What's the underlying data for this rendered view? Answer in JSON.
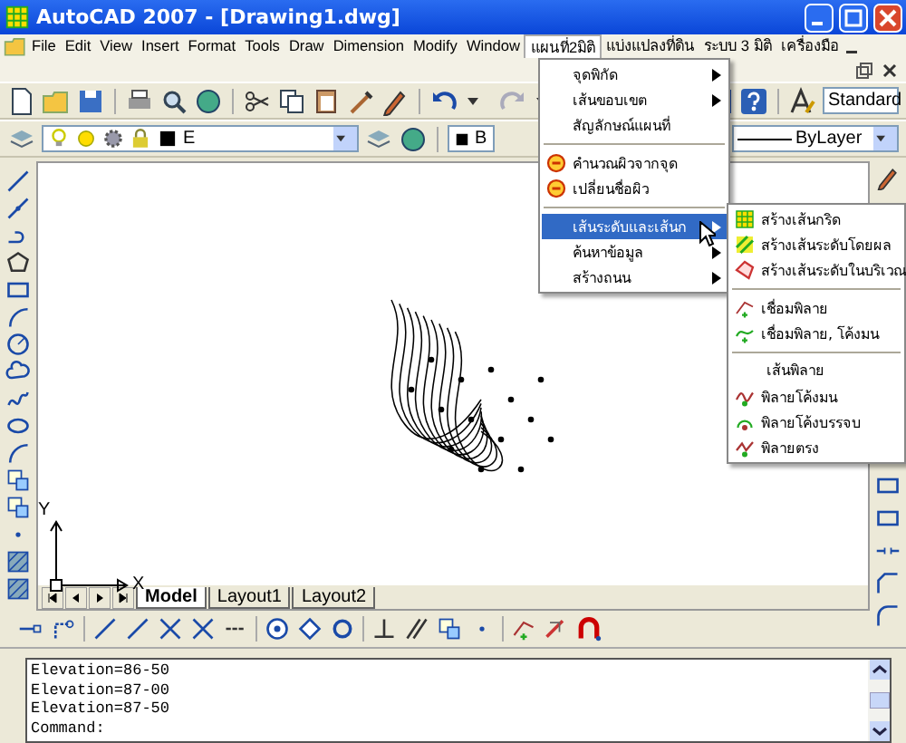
{
  "window": {
    "title": "AutoCAD 2007 - [Drawing1.dwg]"
  },
  "menu_bar": [
    {
      "label": "File",
      "selected": false
    },
    {
      "label": "Edit",
      "selected": false
    },
    {
      "label": "View",
      "selected": false
    },
    {
      "label": "Insert",
      "selected": false
    },
    {
      "label": "Format",
      "selected": false
    },
    {
      "label": "Tools",
      "selected": false
    },
    {
      "label": "Draw",
      "selected": false
    },
    {
      "label": "Dimension",
      "selected": false
    },
    {
      "label": "Modify",
      "selected": false
    },
    {
      "label": "Window",
      "selected": false
    },
    {
      "label": "แผนที่2มิติ",
      "selected": true
    },
    {
      "label": "แบ่งแปลงที่ดิน",
      "selected": false
    },
    {
      "label": "ระบบ 3 มิติ",
      "selected": false
    },
    {
      "label": "เครื่องมือ",
      "selected": false
    }
  ],
  "toolbar": {
    "text_style": "Standard"
  },
  "layers": {
    "current_layer": "E",
    "color_name": "B",
    "linetype": "ByLayer"
  },
  "drawing": {
    "axis_x": "X",
    "axis_y": "Y",
    "tabs": [
      {
        "label": "Model",
        "selected": true
      },
      {
        "label": "Layout1",
        "selected": false
      },
      {
        "label": "Layout2",
        "selected": false
      }
    ]
  },
  "menu": [
    {
      "kind": "item",
      "label": "จุดพิกัด",
      "has_icon": false,
      "submenu": true,
      "selected": false
    },
    {
      "kind": "item",
      "label": "เส้นขอบเขต",
      "has_icon": false,
      "submenu": true,
      "selected": false
    },
    {
      "kind": "item",
      "label": "สัญลักษณ์แผนที่",
      "has_icon": false,
      "submenu": false,
      "selected": false
    },
    {
      "kind": "separator"
    },
    {
      "kind": "item",
      "label": "คำนวณผิวจากจุด",
      "has_icon": true,
      "submenu": false,
      "selected": false
    },
    {
      "kind": "item",
      "label": "เปลี่ยนชื่อผิว",
      "has_icon": true,
      "submenu": false,
      "selected": false
    },
    {
      "kind": "separator"
    },
    {
      "kind": "item",
      "label": "เส้นระดับและเส้นก",
      "has_icon": false,
      "submenu": true,
      "selected": true
    },
    {
      "kind": "item",
      "label": "ค้นหาข้อมูล",
      "has_icon": false,
      "submenu": true,
      "selected": false
    },
    {
      "kind": "item",
      "label": "สร้างถนน",
      "has_icon": false,
      "submenu": true,
      "selected": false
    }
  ],
  "submenu": [
    {
      "kind": "item",
      "label": "สร้างเส้นกริด",
      "has_icon": true,
      "submenu": false,
      "selected": false
    },
    {
      "kind": "item",
      "label": "สร้างเส้นระดับโดยผล",
      "has_icon": true,
      "submenu": false,
      "selected": false
    },
    {
      "kind": "item",
      "label": "สร้างเส้นระดับในบริเวณ",
      "has_icon": true,
      "submenu": false,
      "selected": false
    },
    {
      "kind": "separator"
    },
    {
      "kind": "item",
      "label": "เชื่อมพิลาย",
      "has_icon": true,
      "submenu": false,
      "selected": false
    },
    {
      "kind": "item",
      "label": "เชื่อมพิลาย, โค้งมน",
      "has_icon": true,
      "submenu": false,
      "selected": false
    },
    {
      "kind": "separator"
    },
    {
      "kind": "header",
      "label": "เส้นพิลาย"
    },
    {
      "kind": "item",
      "label": "พิลายโค้งมน",
      "has_icon": true,
      "submenu": false,
      "selected": false
    },
    {
      "kind": "item",
      "label": "พิลายโค้งบรรจบ",
      "has_icon": true,
      "submenu": false,
      "selected": false
    },
    {
      "kind": "item",
      "label": "พิลายตรง",
      "has_icon": true,
      "submenu": false,
      "selected": false
    }
  ],
  "command_lines": [
    "Elevation=86-50",
    "Elevation=87-00",
    "Elevation=87-50",
    "Command:"
  ]
}
